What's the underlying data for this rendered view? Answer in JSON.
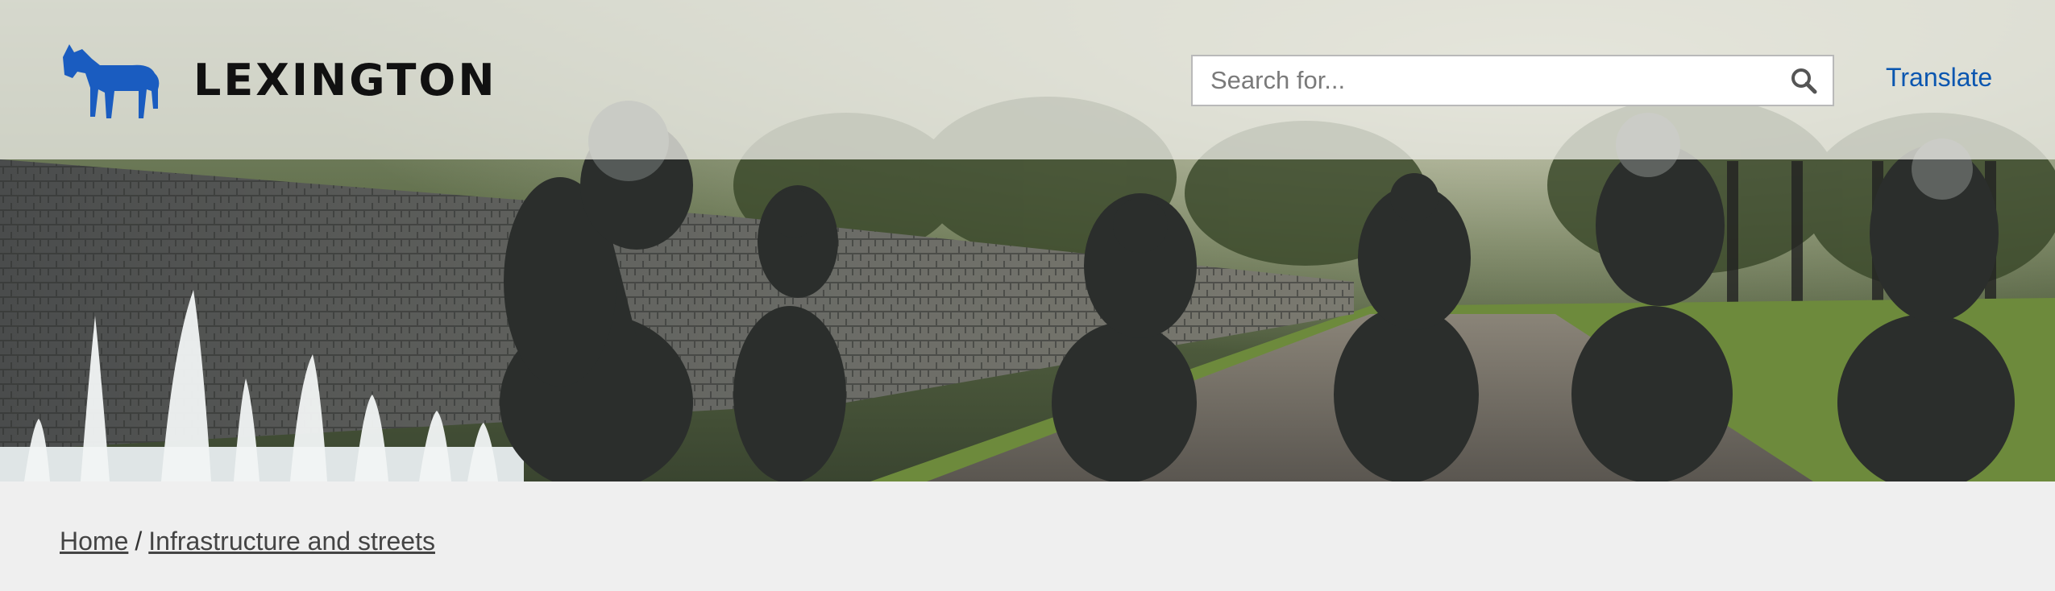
{
  "header": {
    "logo_text": "LEXINGTON",
    "logo_icon": "horse-icon",
    "brand_color": "#1a5cc0"
  },
  "search": {
    "placeholder": "Search for...",
    "value": "",
    "icon": "search-icon"
  },
  "translate_label": "Translate",
  "breadcrumb": {
    "items": [
      "Home",
      "Infrastructure and streets"
    ],
    "separator": "/"
  },
  "hero": {
    "image": "bronze-horse-racing-sculptures-with-fountain"
  },
  "colors": {
    "link": "#0a56b0",
    "page_background": "#efefef"
  }
}
